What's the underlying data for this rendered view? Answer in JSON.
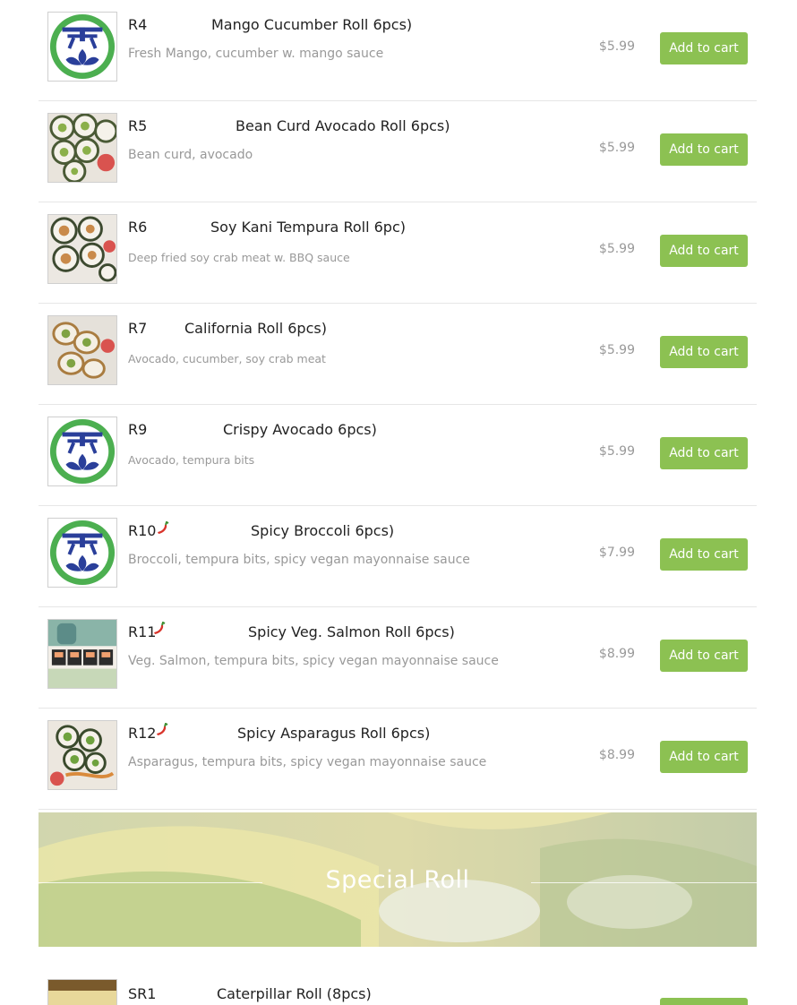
{
  "colors": {
    "accent": "#8cc152",
    "muted": "#999999",
    "title": "#222222"
  },
  "items": [
    {
      "code": "R4",
      "spicy": false,
      "name": "Mango Cucumber Roll   6pcs)",
      "desc": "Fresh Mango, cucumber w. mango sauce",
      "price": "$5.99",
      "button": "Add to cart",
      "image": "logo-icon"
    },
    {
      "code": "R5",
      "spicy": false,
      "name": "Bean Curd Avocado Roll  6pcs)",
      "desc": "Bean curd, avocado",
      "price": "$5.99",
      "button": "Add to cart",
      "image": "sushi-photo"
    },
    {
      "code": "R6",
      "spicy": false,
      "name": "Soy Kani Tempura Roll  6pc)",
      "desc": "Deep fried soy crab meat w. BBQ sauce",
      "price": "$5.99",
      "button": "Add to cart",
      "image": "sushi-photo"
    },
    {
      "code": "R7",
      "spicy": false,
      "name": "California Roll  6pcs)",
      "desc": "Avocado, cucumber, soy crab meat",
      "price": "$5.99",
      "button": "Add to cart",
      "image": "sushi-photo"
    },
    {
      "code": "R9",
      "spicy": false,
      "name": "Crispy Avocado   6pcs)",
      "desc": "Avocado, tempura bits",
      "price": "$5.99",
      "button": "Add to cart",
      "image": "logo-icon"
    },
    {
      "code": "R10",
      "spicy": true,
      "name": "Spicy Broccoli   6pcs)",
      "desc": "Broccoli, tempura bits, spicy vegan mayonnaise sauce",
      "price": "$7.99",
      "button": "Add to cart",
      "image": "logo-icon"
    },
    {
      "code": "R11",
      "spicy": true,
      "name": "Spicy Veg. Salmon Roll    6pcs)",
      "desc": "Veg. Salmon, tempura bits, spicy vegan mayonnaise sauce",
      "price": "$8.99",
      "button": "Add to cart",
      "image": "sushi-photo"
    },
    {
      "code": "R12",
      "spicy": true,
      "name": "Spicy Asparagus Roll    6pcs)",
      "desc": "Asparagus, tempura bits, spicy vegan mayonnaise sauce",
      "price": "$8.99",
      "button": "Add to cart",
      "image": "sushi-photo"
    }
  ],
  "section": {
    "title": "Special Roll"
  },
  "next_item": {
    "code": "SR1",
    "name": "Caterpillar Roll (8pcs)",
    "image": "sushi-photo"
  },
  "icons": {
    "spicy": "chili-pepper-icon"
  }
}
